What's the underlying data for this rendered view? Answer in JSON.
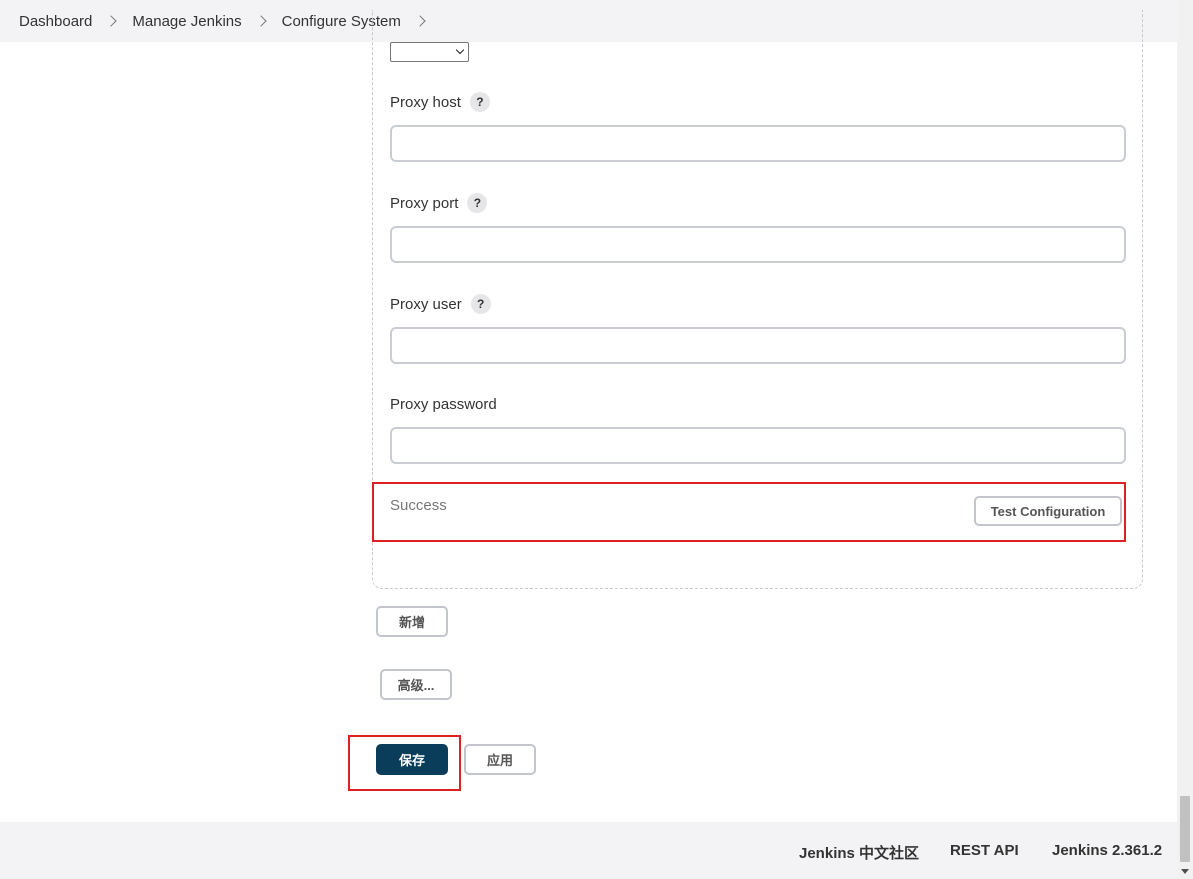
{
  "breadcrumb": [
    "Dashboard",
    "Manage Jenkins",
    "Configure System"
  ],
  "fields": {
    "proxy_host": {
      "label": "Proxy host",
      "value": ""
    },
    "proxy_port": {
      "label": "Proxy port",
      "value": ""
    },
    "proxy_user": {
      "label": "Proxy user",
      "value": ""
    },
    "proxy_password": {
      "label": "Proxy password",
      "value": ""
    }
  },
  "help_icon_text": "?",
  "test": {
    "status": "Success",
    "button_label": "Test Configuration"
  },
  "buttons": {
    "add": "新增",
    "advanced": "高级...",
    "save": "保存",
    "apply": "应用"
  },
  "footer": {
    "community": "Jenkins 中文社区",
    "rest_api": "REST API",
    "version": "Jenkins 2.361.2"
  },
  "colors": {
    "primary_button": "#0a3d5a",
    "highlight": "#e02020"
  }
}
